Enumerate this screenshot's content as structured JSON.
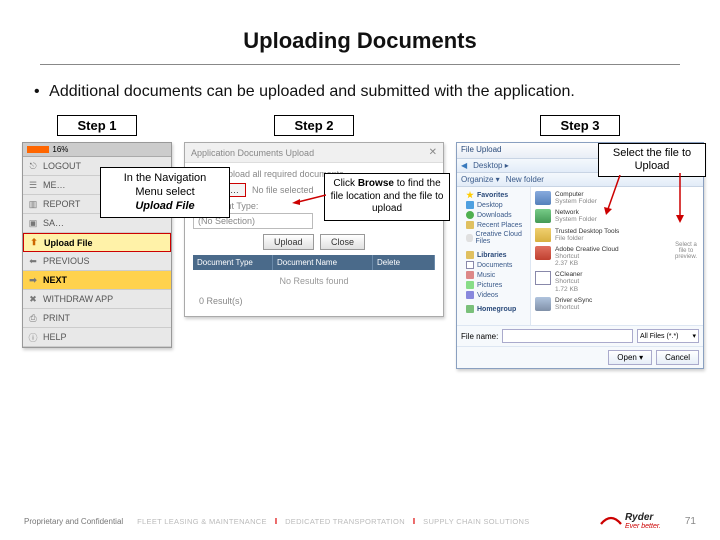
{
  "title": "Uploading Documents",
  "bullet": "Additional documents can be uploaded and submitted with the application.",
  "steps": {
    "s1": "Step 1",
    "s2": "Step 2",
    "s3": "Step 3"
  },
  "nav": {
    "progress_pct": "16%",
    "items": {
      "logout": "LOGOUT",
      "me": "ME…",
      "report": "REPORT",
      "sa": "SA…",
      "upload": "Upload File",
      "previous": "PREVIOUS",
      "next": "NEXT",
      "withdraw": "WITHDRAW APP",
      "print": "PRINT",
      "help": "HELP"
    }
  },
  "callout1": {
    "line1": "In the Navigation",
    "line2": "Menu select",
    "line3_strong": "Upload File"
  },
  "upload": {
    "title": "Application Documents Upload",
    "instr": "Please upload all required documents.",
    "browse": "Browse…",
    "nofile": "No file selected",
    "doctype_label": "Document Type:",
    "doctype_value": "(No Selection)",
    "upload_btn": "Upload",
    "close_btn": "Close",
    "col1": "Document Type",
    "col2": "Document Name",
    "col3": "Delete",
    "nores": "No Results found",
    "count": "0 Result(s)"
  },
  "callout2": {
    "pre": "Click ",
    "strong": "Browse",
    "post": " to find the file location and the file to upload"
  },
  "filedlg": {
    "title": "File Upload",
    "breadcrumb": "Desktop ▸",
    "organize": "Organize ▾",
    "newfolder": "New folder",
    "nav": {
      "favorites": "Favorites",
      "desktop": "Desktop",
      "downloads": "Downloads",
      "recent": "Recent Places",
      "cloud": "Creative Cloud Files",
      "libraries": "Libraries",
      "documents": "Documents",
      "music": "Music",
      "pictures": "Pictures",
      "videos": "Videos",
      "homegroup": "Homegroup"
    },
    "files": {
      "computer": "Computer",
      "computer_sub": "System Folder",
      "network": "Network",
      "network_sub": "System Folder",
      "tdt": "Trusted Desktop Tools",
      "tdt_sub": "File folder",
      "acc": "Adobe Creative Cloud",
      "acc_sub": "Shortcut",
      "acc_size": "2.37 KB",
      "cc": "CCleaner",
      "cc_sub": "Shortcut",
      "cc_size": "1.72 KB",
      "da": "Driver eSync",
      "da_sub": "Shortcut"
    },
    "side_hint": "Select a file to preview.",
    "filename_label": "File name:",
    "filter": "All Files (*.*)",
    "open": "Open",
    "cancel": "Cancel"
  },
  "callout3": {
    "line1": "Select the file to",
    "line2": "Upload"
  },
  "footer": {
    "left": "Proprietary and Confidential",
    "m1": "FLEET LEASING & MAINTENANCE",
    "m2": "DEDICATED TRANSPORTATION",
    "m3": "SUPPLY CHAIN SOLUTIONS",
    "brand": "Ryder",
    "tag": "Ever better.",
    "page": "71"
  }
}
